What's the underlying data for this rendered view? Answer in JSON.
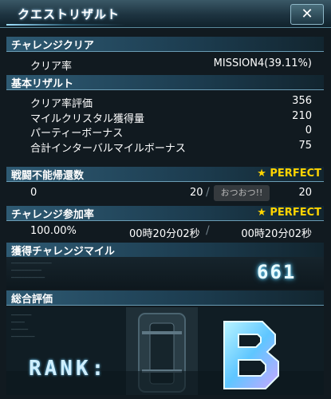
{
  "window": {
    "title": "クエストリザルト",
    "close_label": "✕"
  },
  "challenge_clear": {
    "header": "チャレンジクリア",
    "label": "クリア率",
    "value": "MISSION4(39.11%)"
  },
  "basic_result": {
    "header": "基本リザルト",
    "rows": [
      {
        "label": "クリア率評価",
        "value": "356"
      },
      {
        "label": "マイルクリスタル獲得量",
        "value": "210"
      },
      {
        "label": "パーティーボーナス",
        "value": "0"
      },
      {
        "label": "合計インターバルマイルボーナス",
        "value": "75"
      }
    ]
  },
  "incapacitation_returns": {
    "header": "戦闘不能帰還数",
    "rating": "★ PERFECT",
    "count": "0",
    "limit": "20",
    "target": "20"
  },
  "participation": {
    "header": "チャレンジ参加率",
    "rating": "★ PERFECT",
    "rate": "100.00%",
    "time_a": "00時20分02秒",
    "time_b": "00時20分02秒"
  },
  "miles": {
    "header": "獲得チャレンジマイル",
    "value": "661"
  },
  "overall": {
    "header": "総合評価",
    "rank_label": "RANK:",
    "rank": "B"
  },
  "overlay": {
    "chat_bubble": "おつおつ!!"
  },
  "colors": {
    "perfect": "#ffd400",
    "header_bg": "#2e5a73",
    "rank_glow": "#7fe8ff"
  }
}
